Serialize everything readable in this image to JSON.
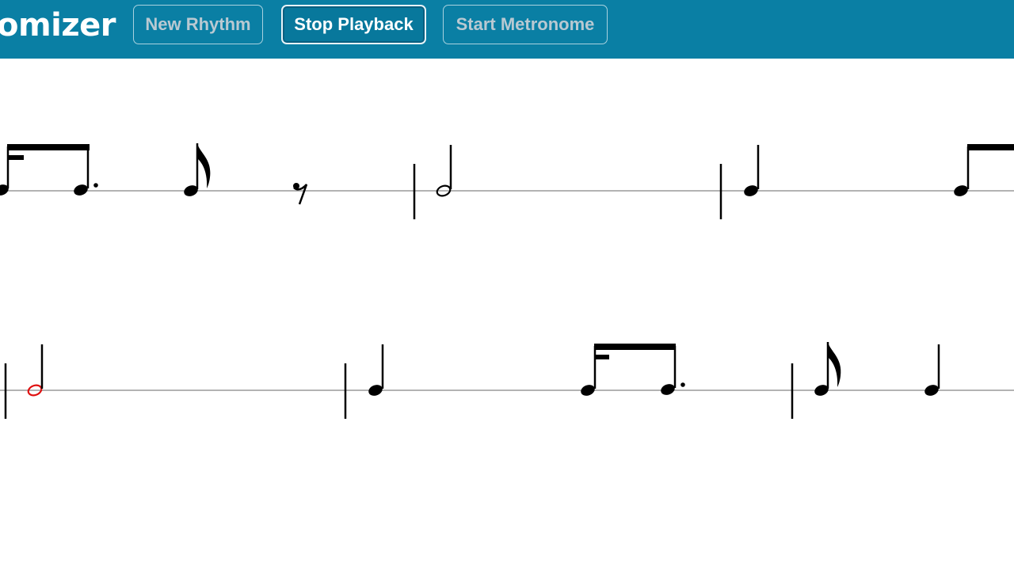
{
  "header": {
    "brand_text": "omizer",
    "buttons": {
      "new_rhythm": "New Rhythm",
      "stop_playback": "Stop Playback",
      "start_metronome": "Start Metronome"
    }
  },
  "colors": {
    "header_bg": "#0a7fa4",
    "staff_line": "#9a9a9a",
    "note": "#000000",
    "current_note": "#e01010"
  },
  "score": {
    "rows": [
      {
        "row": 1,
        "symbols": [
          "dotted-eighth-sixteenth-beam (partial)",
          "dotted-eighth",
          "eighth",
          "eighth-rest",
          "barline",
          "half",
          "barline",
          "quarter",
          "eighth-beam (partial)"
        ]
      },
      {
        "row": 2,
        "symbols": [
          "barline",
          "half (current)",
          "barline",
          "quarter",
          "sixteenth-dotted-eighth-beam",
          "barline",
          "eighth",
          "quarter"
        ]
      }
    ],
    "playhead_note": "row 2, half note"
  }
}
